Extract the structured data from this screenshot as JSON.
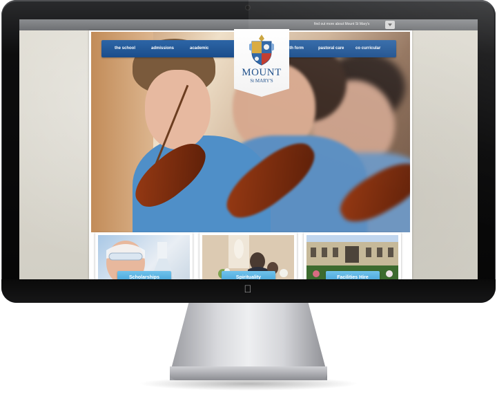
{
  "topbar": {
    "find_out_more": "find out more about Mount St Mary's",
    "dropdown_icon": "chevron-down-icon"
  },
  "nav": {
    "items": [
      {
        "label": "the school"
      },
      {
        "label": "admissions"
      },
      {
        "label": "academic"
      },
      {
        "label": "6th form"
      },
      {
        "label": "pastoral care"
      },
      {
        "label": "co curricular"
      }
    ]
  },
  "logo": {
    "name": "MOUNT",
    "subname": "St MARY'S",
    "crest_icon": "crest-icon"
  },
  "tiles": [
    {
      "label": "Scholarships"
    },
    {
      "label": "Spirituality"
    },
    {
      "label": "Facilities Hire"
    }
  ],
  "colors": {
    "nav_blue": "#1a4d8b",
    "tile_button": "#3e9cd2",
    "logo_blue": "#1e4f8a"
  }
}
